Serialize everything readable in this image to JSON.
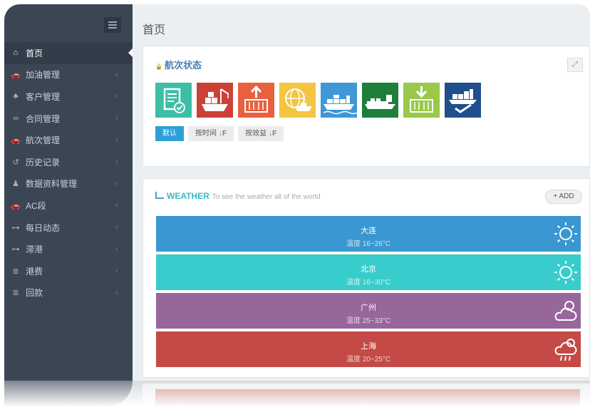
{
  "sidebar": {
    "items": [
      {
        "label": "首页",
        "icon": "home-icon",
        "glyph": "⌂",
        "active": true
      },
      {
        "label": "加油管理",
        "icon": "car-icon",
        "glyph": "🚗"
      },
      {
        "label": "客户管理",
        "icon": "user-icon",
        "glyph": "♣"
      },
      {
        "label": "合同管理",
        "icon": "handshake-icon",
        "glyph": "∞"
      },
      {
        "label": "航次管理",
        "icon": "car-icon",
        "glyph": "🚗"
      },
      {
        "label": "历史记录",
        "icon": "history-icon",
        "glyph": "↺"
      },
      {
        "label": "数据资料管理",
        "icon": "user-icon",
        "glyph": "♟"
      },
      {
        "label": "AC段",
        "icon": "car-icon",
        "glyph": "🚗"
      },
      {
        "label": "每日动态",
        "icon": "key-icon",
        "glyph": "⊶"
      },
      {
        "label": "滞港",
        "icon": "key-icon",
        "glyph": "⊶"
      },
      {
        "label": "港费",
        "icon": "list-icon",
        "glyph": "≣"
      },
      {
        "label": "回款",
        "icon": "list-icon",
        "glyph": "≣"
      }
    ],
    "chevron": "‹"
  },
  "page": {
    "title": "首页"
  },
  "voyage_panel": {
    "title": "航次状态",
    "title_icon": "lock-icon",
    "expand_icon": "expand-icon",
    "tiles": [
      {
        "icon": "checklist-icon",
        "color": "#3dbfa6"
      },
      {
        "icon": "ship-crane-icon",
        "color": "#cb4138"
      },
      {
        "icon": "container-unload-icon",
        "color": "#e7613f"
      },
      {
        "icon": "globe-ship-icon",
        "color": "#f4c443"
      },
      {
        "icon": "container-ship-icon",
        "color": "#3e98d6"
      },
      {
        "icon": "cargo-ship-icon",
        "color": "#1e7e3a"
      },
      {
        "icon": "container-load-icon",
        "color": "#99c84a"
      },
      {
        "icon": "ship-check-icon",
        "color": "#1f4f8d"
      }
    ],
    "sort_buttons": [
      {
        "label": "默认",
        "active": true,
        "sort_icon": ""
      },
      {
        "label": "按时间",
        "active": false,
        "sort_icon": "↓F"
      },
      {
        "label": "按效益",
        "active": false,
        "sort_icon": "↓F"
      }
    ]
  },
  "weather_panel": {
    "title": "WEATHER",
    "subtitle": "To see the weather all of the world",
    "add_label": "+ ADD",
    "rows": [
      {
        "city": "大连",
        "temp": "温度 16~26°C",
        "icon": "sun-icon",
        "color": "#3a97d2"
      },
      {
        "city": "北京",
        "temp": "温度 16~30°C",
        "icon": "sun-icon",
        "color": "#38cccc"
      },
      {
        "city": "广州",
        "temp": "温度 25~33°C",
        "icon": "cloud-sun-icon",
        "color": "#97669b"
      },
      {
        "city": "上海",
        "temp": "温度 20~25°C",
        "icon": "cloud-rain-icon",
        "color": "#c44a45"
      }
    ]
  }
}
